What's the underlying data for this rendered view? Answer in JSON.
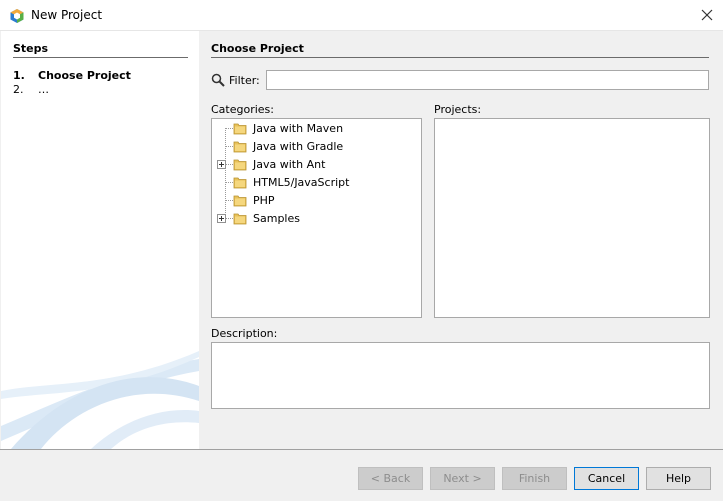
{
  "window": {
    "title": "New Project",
    "icon": "netbeans-cube-icon",
    "close_icon": "close-icon"
  },
  "steps": {
    "heading": "Steps",
    "items": [
      {
        "num": "1.",
        "label": "Choose Project",
        "active": true
      },
      {
        "num": "2.",
        "label": "…",
        "active": false
      }
    ]
  },
  "main": {
    "heading": "Choose Project",
    "filter": {
      "label": "Filter:",
      "value": "",
      "placeholder": "",
      "icon": "search-icon"
    },
    "categories": {
      "label": "Categories:",
      "items": [
        {
          "label": "Java with Maven",
          "expandable": false
        },
        {
          "label": "Java with Gradle",
          "expandable": false
        },
        {
          "label": "Java with Ant",
          "expandable": true
        },
        {
          "label": "HTML5/JavaScript",
          "expandable": false
        },
        {
          "label": "PHP",
          "expandable": false
        },
        {
          "label": "Samples",
          "expandable": true
        }
      ]
    },
    "projects": {
      "label": "Projects:"
    },
    "description": {
      "label": "Description:",
      "value": ""
    }
  },
  "buttons": {
    "back": "< Back",
    "next": "Next >",
    "finish": "Finish",
    "cancel": "Cancel",
    "help": "Help"
  },
  "colors": {
    "window_bg": "#f0f0f0",
    "panel_bg": "#ffffff",
    "focus_border": "#0078d7",
    "folder_yellow": "#e8c25a"
  }
}
